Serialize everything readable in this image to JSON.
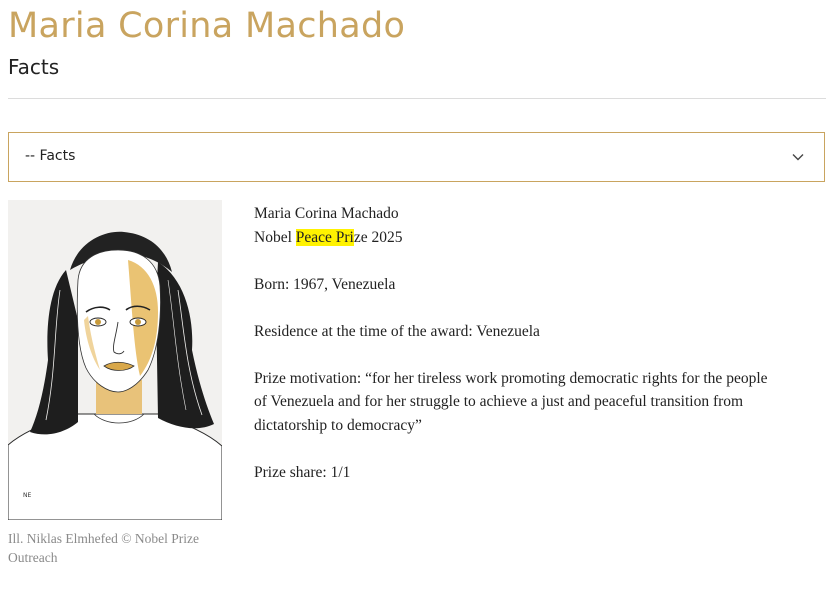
{
  "header": {
    "title": "Maria Corina Machado",
    "subtitle": "Facts"
  },
  "select": {
    "label": "-- Facts",
    "icon": "chevron-down-icon"
  },
  "portrait": {
    "signature": "NE"
  },
  "caption": "Ill. Niklas Elmhefed © Nobel Prize Outreach",
  "facts": {
    "name": "Maria Corina Machado",
    "prize_prefix": "Nobel ",
    "prize_highlight": "Peace Pri",
    "prize_suffix": "ze 2025",
    "born": "Born: 1967, Venezuela",
    "residence": "Residence at the time of the award: Venezuela",
    "motivation": "Prize motivation: “for her tireless work promoting democratic rights for the people of Venezuela and for her struggle to achieve a just and peaceful transition from dictatorship to democracy”",
    "share": "Prize share: 1/1"
  },
  "colors": {
    "accent_gold": "#c9a45f",
    "highlight": "#fff200"
  }
}
